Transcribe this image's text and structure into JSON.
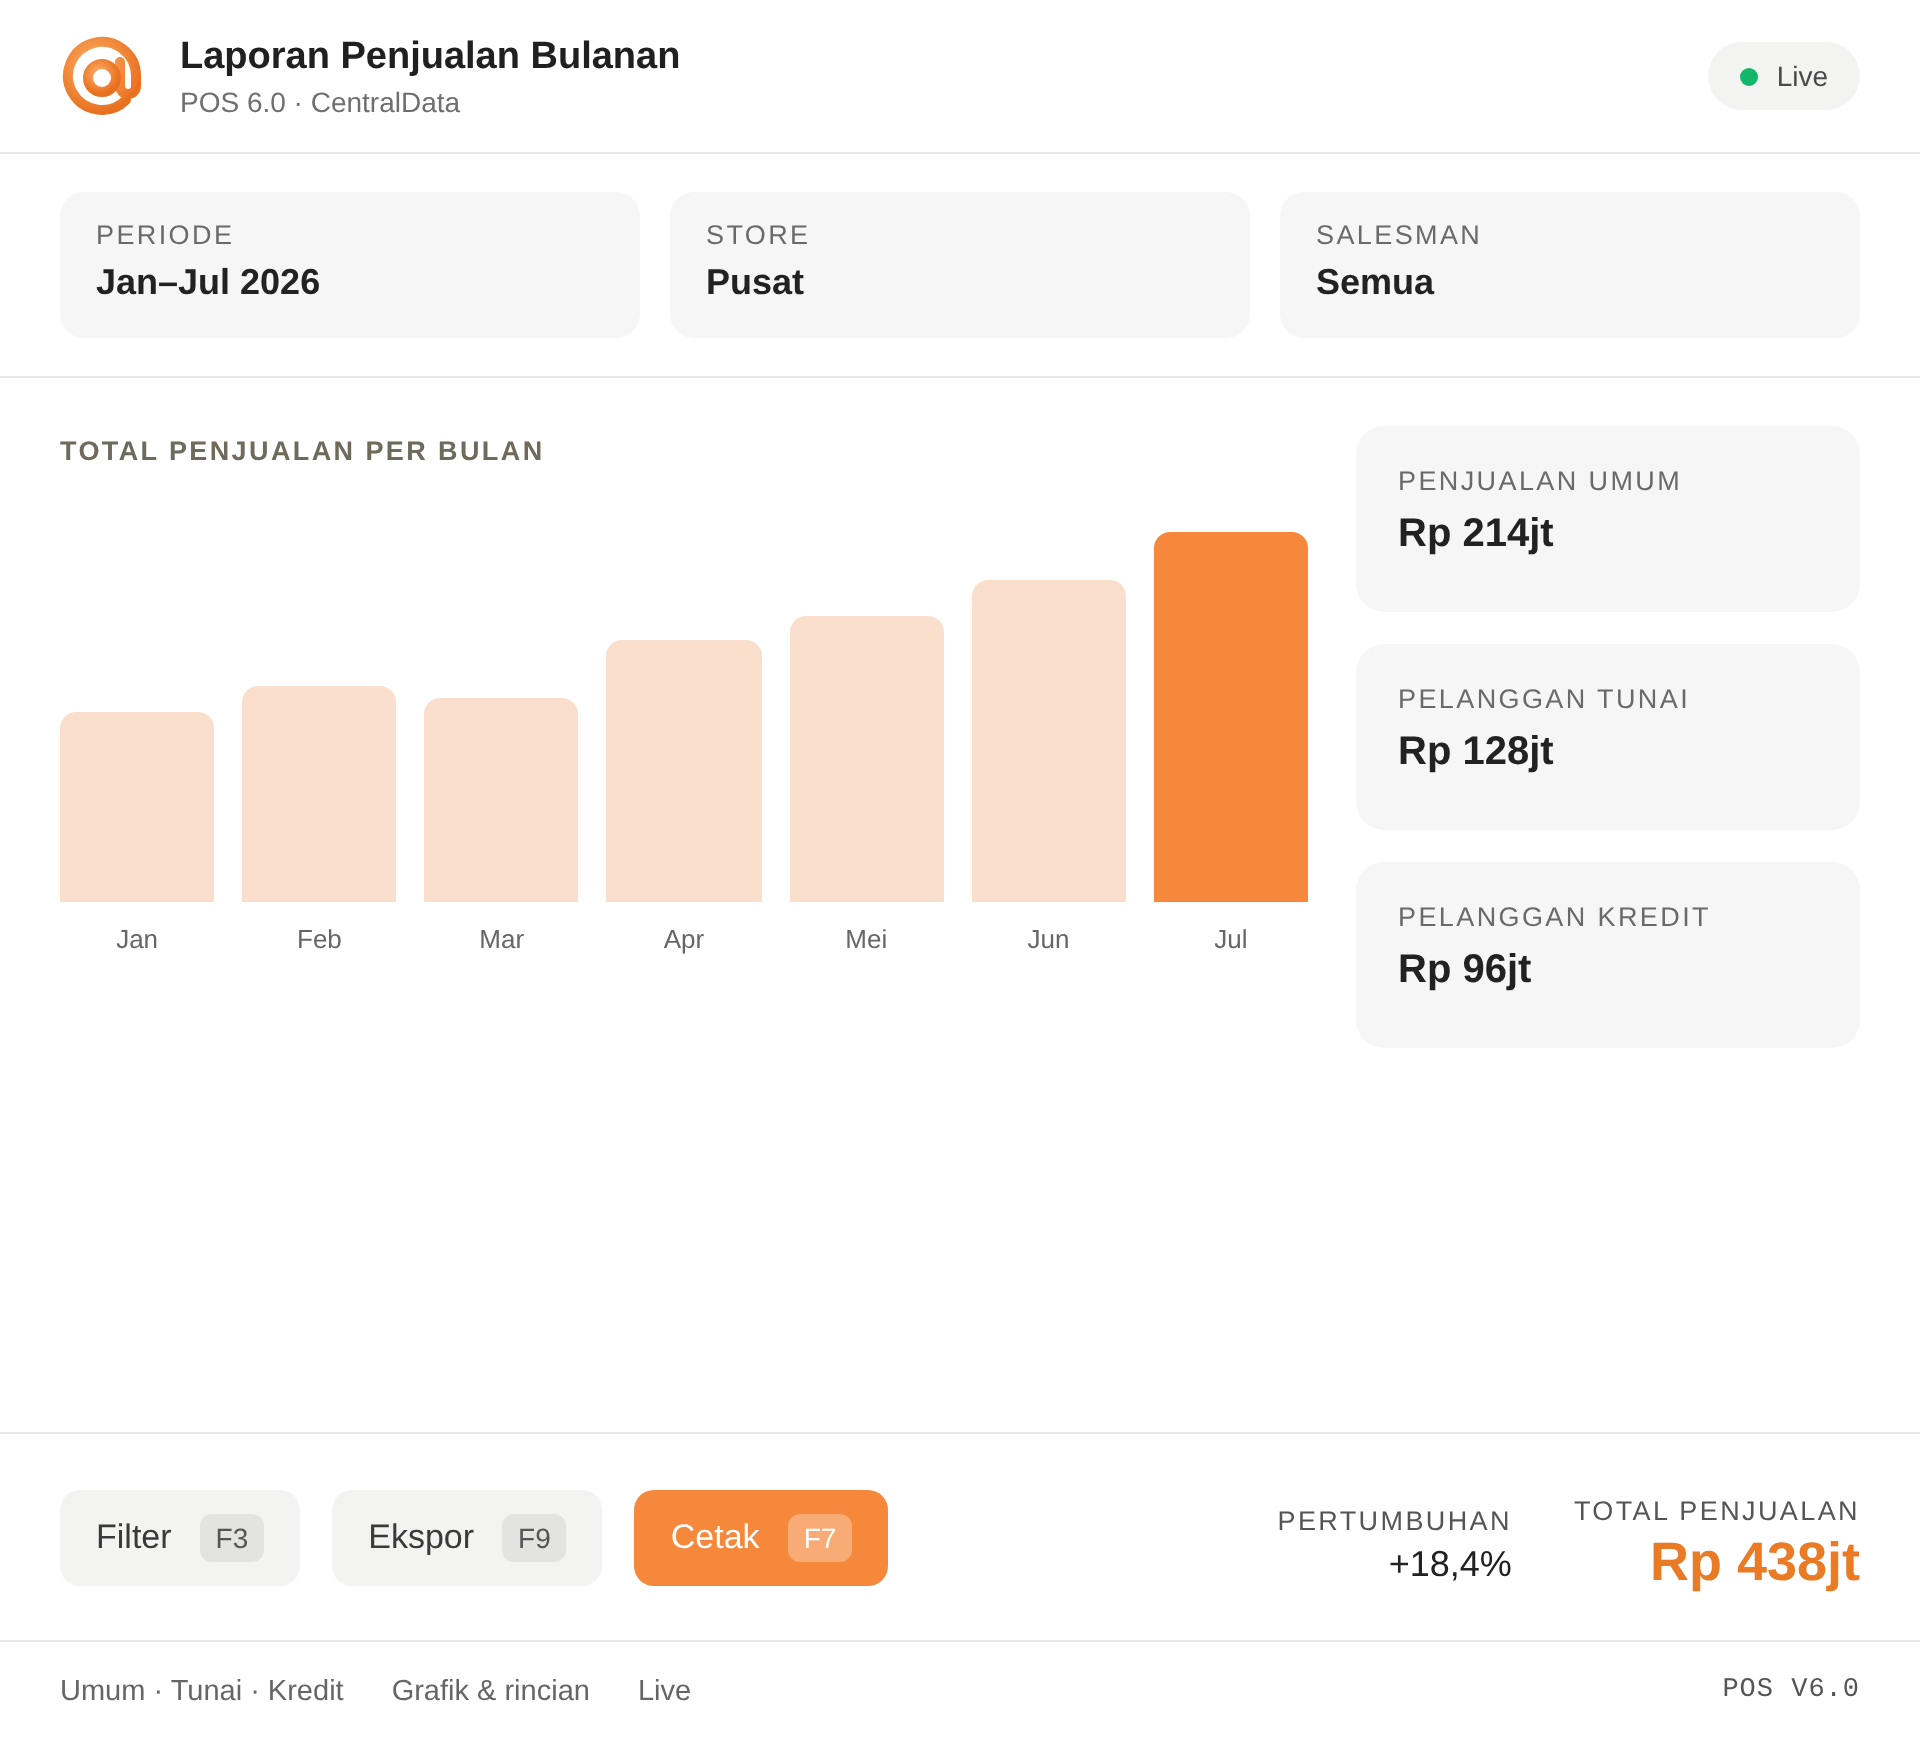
{
  "header": {
    "title": "Laporan Penjualan Bulanan",
    "subtitle": "POS 6.0 · CentralData",
    "status": {
      "label": "Live",
      "live": true
    }
  },
  "filters": [
    {
      "label": "PERIODE",
      "value": "Jan–Jul 2026"
    },
    {
      "label": "STORE",
      "value": "Pusat"
    },
    {
      "label": "SALESMAN",
      "value": "Semua"
    }
  ],
  "chart": {
    "title": "TOTAL PENJUALAN PER BULAN",
    "months": [
      {
        "label": "Jan",
        "selected": false
      },
      {
        "label": "Feb",
        "selected": false
      },
      {
        "label": "Mar",
        "selected": false
      },
      {
        "label": "Apr",
        "selected": false
      },
      {
        "label": "Mei",
        "selected": false
      },
      {
        "label": "Jun",
        "selected": false
      },
      {
        "label": "Jul",
        "selected": true
      }
    ]
  },
  "stats": [
    {
      "label": "PENJUALAN UMUM",
      "value": "Rp 214jt"
    },
    {
      "label": "PELANGGAN TUNAI",
      "value": "Rp 128jt"
    },
    {
      "label": "PELANGGAN KREDIT",
      "value": "Rp 96jt"
    }
  ],
  "actions": [
    {
      "label": "Filter",
      "key": "F3",
      "kind": "secondary"
    },
    {
      "label": "Ekspor",
      "key": "F9",
      "kind": "secondary"
    },
    {
      "label": "Cetak",
      "key": "F7",
      "kind": "primary"
    }
  ],
  "summary": {
    "growth": {
      "label": "PERTUMBUHAN",
      "value": "+18,4%"
    },
    "total": {
      "label": "TOTAL PENJUALAN",
      "value": "Rp 438jt"
    }
  },
  "footer": {
    "links": [
      "Umum · Tunai · Kredit",
      "Grafik & rincian",
      "Live"
    ],
    "version": "POS V6.0"
  }
}
